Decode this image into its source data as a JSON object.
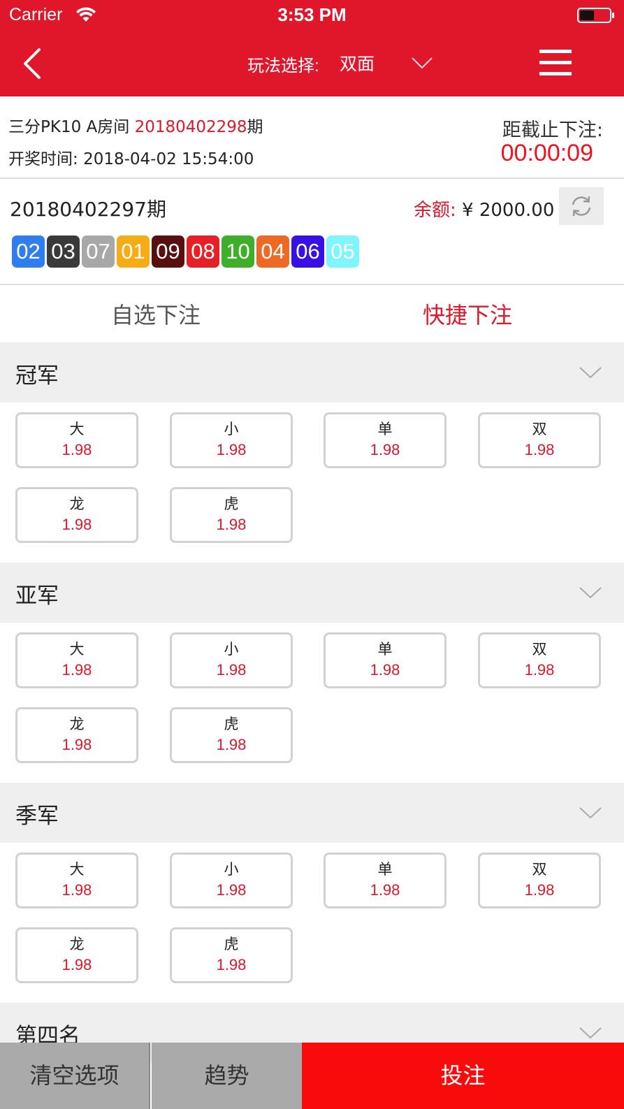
{
  "status_bar": {
    "carrier": "Carrier",
    "time": "3:53 PM"
  },
  "nav": {
    "play_label": "玩法选择:",
    "play_value": "双面"
  },
  "draw": {
    "game_room": "三分PK10 A房间",
    "issue": "20180402298",
    "issue_suffix": "期",
    "draw_time_label": "开奖时间:",
    "draw_time": "2018-04-02 15:54:00",
    "deadline_label": "距截止下注:",
    "countdown": "00:00:09"
  },
  "last": {
    "issue": "20180402297期",
    "balance_label": "余额:",
    "balance_value": "¥ 2000.00",
    "balls": [
      {
        "num": "02",
        "color": "#2f7ef1"
      },
      {
        "num": "03",
        "color": "#3a3a3a"
      },
      {
        "num": "07",
        "color": "#a8a8a8"
      },
      {
        "num": "01",
        "color": "#f7ab14"
      },
      {
        "num": "09",
        "color": "#5a0f0f"
      },
      {
        "num": "08",
        "color": "#e81f26"
      },
      {
        "num": "10",
        "color": "#3fae2a"
      },
      {
        "num": "04",
        "color": "#ee6a24"
      },
      {
        "num": "06",
        "color": "#3810e6"
      },
      {
        "num": "05",
        "color": "#7ff5ff"
      }
    ]
  },
  "tabs": {
    "custom": "自选下注",
    "quick": "快捷下注"
  },
  "sections": [
    {
      "title": "冠军",
      "options": [
        {
          "name": "大",
          "odds": "1.98"
        },
        {
          "name": "小",
          "odds": "1.98"
        },
        {
          "name": "单",
          "odds": "1.98"
        },
        {
          "name": "双",
          "odds": "1.98"
        },
        {
          "name": "龙",
          "odds": "1.98"
        },
        {
          "name": "虎",
          "odds": "1.98"
        }
      ]
    },
    {
      "title": "亚军",
      "options": [
        {
          "name": "大",
          "odds": "1.98"
        },
        {
          "name": "小",
          "odds": "1.98"
        },
        {
          "name": "单",
          "odds": "1.98"
        },
        {
          "name": "双",
          "odds": "1.98"
        },
        {
          "name": "龙",
          "odds": "1.98"
        },
        {
          "name": "虎",
          "odds": "1.98"
        }
      ]
    },
    {
      "title": "季军",
      "options": [
        {
          "name": "大",
          "odds": "1.98"
        },
        {
          "name": "小",
          "odds": "1.98"
        },
        {
          "name": "单",
          "odds": "1.98"
        },
        {
          "name": "双",
          "odds": "1.98"
        },
        {
          "name": "龙",
          "odds": "1.98"
        },
        {
          "name": "虎",
          "odds": "1.98"
        }
      ]
    },
    {
      "title": "第四名",
      "options": []
    }
  ],
  "bottom": {
    "clear": "清空选项",
    "trend": "趋势",
    "bet": "投注"
  },
  "colors": {
    "brand_red": "#e0162b",
    "bet_red": "#fa0b0b"
  },
  "icons": [
    "wifi-icon",
    "battery-icon",
    "back-icon",
    "chevron-down-icon",
    "menu-icon",
    "refresh-icon"
  ]
}
